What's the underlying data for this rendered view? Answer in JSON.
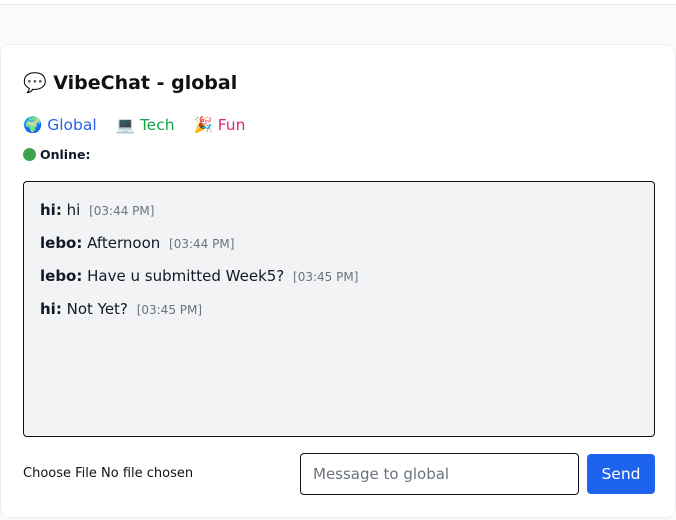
{
  "header": {
    "icon": "speech-bubble-icon",
    "title": "💬 VibeChat - global"
  },
  "rooms": [
    {
      "label": "🌍 Global",
      "color": "#2563eb"
    },
    {
      "label": "💻 Tech",
      "color": "#16a34a"
    },
    {
      "label": "🎉 Fun",
      "color": "#db2777"
    }
  ],
  "online": {
    "icon": "green-circle-icon",
    "label": "Online:",
    "color": "#3fa34d"
  },
  "messages": [
    {
      "user": "hi:",
      "text": "hi",
      "time": "[03:44 PM]"
    },
    {
      "user": "lebo:",
      "text": "Afternoon",
      "time": "[03:44 PM]"
    },
    {
      "user": "lebo:",
      "text": "Have u submitted Week5?",
      "time": "[03:45 PM]"
    },
    {
      "user": "hi:",
      "text": "Not Yet?",
      "time": "[03:45 PM]"
    }
  ],
  "composer": {
    "file_button": "Choose File",
    "file_status": "No file chosen",
    "placeholder": "Message to global",
    "value": "",
    "send_label": "Send",
    "send_color": "#1d63ed"
  }
}
